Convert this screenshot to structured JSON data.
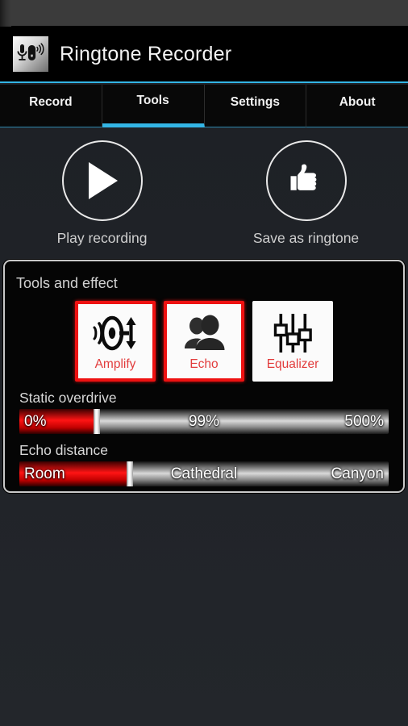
{
  "statusbar": {
    "present": true
  },
  "appbar": {
    "title": "Ringtone Recorder",
    "icon": "microphone-phone-icon"
  },
  "tabs": [
    {
      "label": "Record",
      "active": false
    },
    {
      "label": "Tools",
      "active": true
    },
    {
      "label": "Settings",
      "active": false
    },
    {
      "label": "About",
      "active": false
    }
  ],
  "top_actions": [
    {
      "label": "Play recording",
      "icon": "play-icon"
    },
    {
      "label": "Save as ringtone",
      "icon": "thumbs-up-icon"
    }
  ],
  "tools_panel": {
    "title": "Tools and effect",
    "effects": [
      {
        "label": "Amplify",
        "icon": "speaker-updown-arrow-icon",
        "selected": true
      },
      {
        "label": "Echo",
        "icon": "two-people-icon",
        "selected": true
      },
      {
        "label": "Equalizer",
        "icon": "faders-icon",
        "selected": false
      }
    ],
    "sliders": [
      {
        "label": "Static overdrive",
        "start_label": "0%",
        "mid_label": "99%",
        "end_label": "500%",
        "fill_percent": 21,
        "thumb_percent": 21
      },
      {
        "label": "Echo distance",
        "start_label": "Room",
        "mid_label": "Cathedral",
        "end_label": "Canyon",
        "fill_percent": 30,
        "thumb_percent": 30
      }
    ]
  },
  "colors": {
    "accent_blue": "#33b5e5",
    "effect_red": "#ee1111",
    "slider_red": "#ff1414",
    "background": "#1f2227"
  }
}
